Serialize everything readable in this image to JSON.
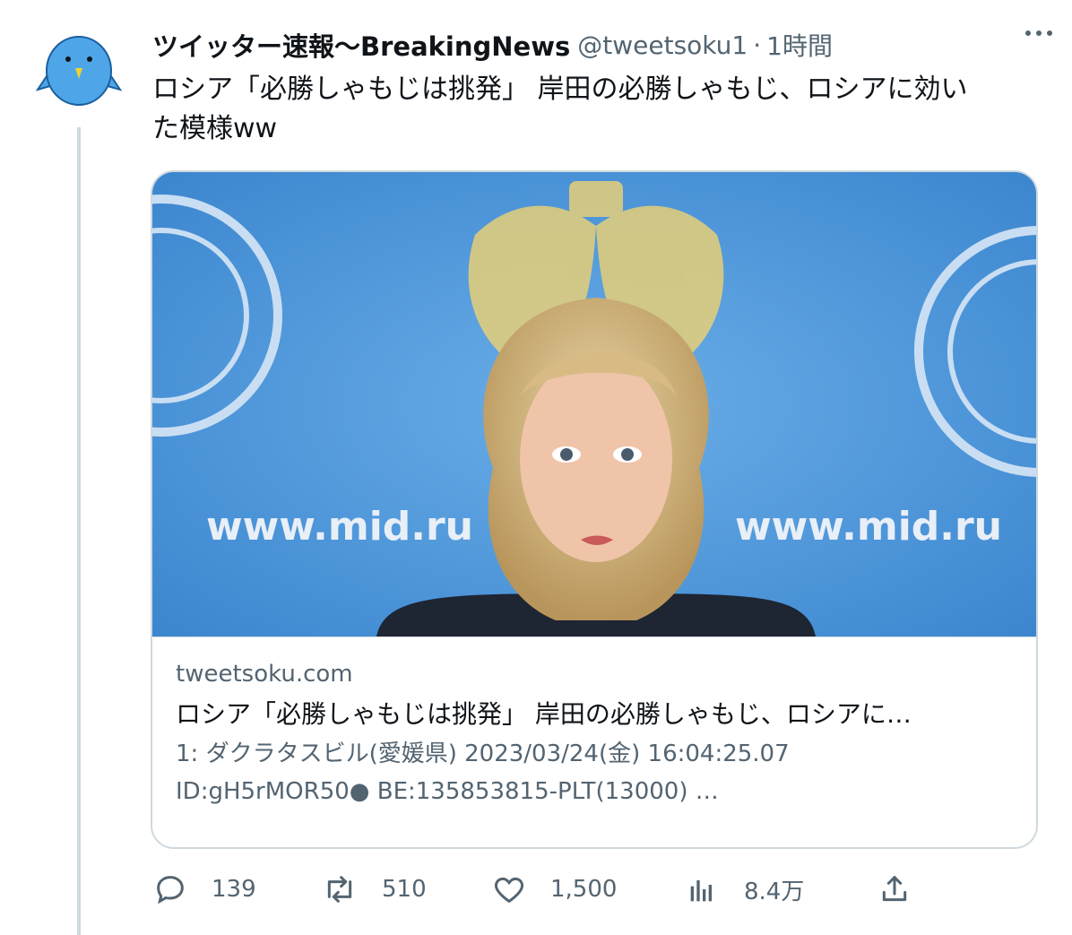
{
  "tweet": {
    "display_name": "ツイッター速報〜BreakingNews",
    "handle": "@tweetsoku1",
    "separator": "·",
    "time": "1時間",
    "text_line1": "ロシア「必勝しゃもじは挑発」 岸田の必勝しゃもじ、ロシアに効い",
    "text_line2": "た模様ww"
  },
  "card": {
    "image_texts": {
      "left_url": "www.mid.ru",
      "right_url": "www.mid.ru"
    },
    "domain": "tweetsoku.com",
    "title": "ロシア「必勝しゃもじは挑発」 岸田の必勝しゃもじ、ロシアに…",
    "desc_line1": "1: ダクラタスビル(愛媛県) 2023/03/24(金) 16:04:25.07",
    "desc_line2": "ID:gH5rMOR50● BE:135853815-PLT(13000) …"
  },
  "actions": {
    "reply": {
      "icon": "reply-icon",
      "count": "139"
    },
    "retweet": {
      "icon": "retweet-icon",
      "count": "510"
    },
    "like": {
      "icon": "heart-icon",
      "count": "1,500"
    },
    "views": {
      "icon": "analytics-icon",
      "count": "8.4万"
    },
    "share": {
      "icon": "share-icon"
    }
  },
  "colors": {
    "text": "#0f1419",
    "secondary": "#536471",
    "border": "#cfd9de",
    "image_bg": "#4a92d6",
    "avatar_blue": "#4ea6e8"
  }
}
